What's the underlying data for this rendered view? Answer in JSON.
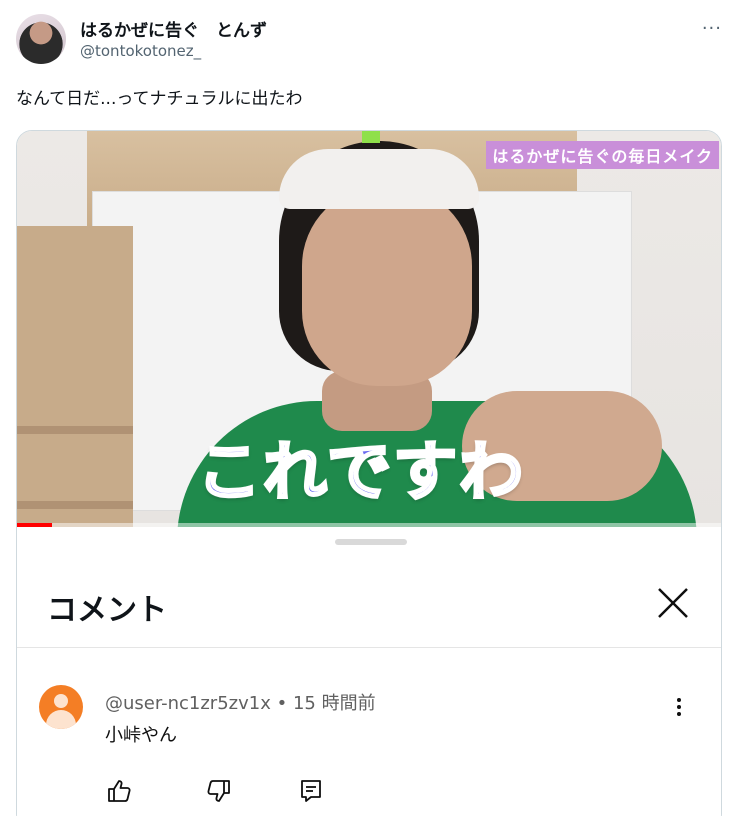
{
  "post": {
    "display_name": "はるかぜに告ぐ　とんず",
    "handle": "@tontokotonez_",
    "more_label": "···",
    "text": "なんて日だ...ってナチュラルに出たわ"
  },
  "video": {
    "overlay_tag": "はるかぜに告ぐの毎日メイク",
    "caption": "これですわ",
    "progress": 0.05
  },
  "comments_sheet": {
    "title": "コメント",
    "comment": {
      "user": "@user-nc1zr5zv1x",
      "separator": "•",
      "time": "15 時間前",
      "text": "小峠やん"
    }
  },
  "colors": {
    "caption": "#6a6af0",
    "overlay_tag_bg": "#c98fd9",
    "avatar_orange": "#f47e25",
    "progress": "#ff0000"
  }
}
